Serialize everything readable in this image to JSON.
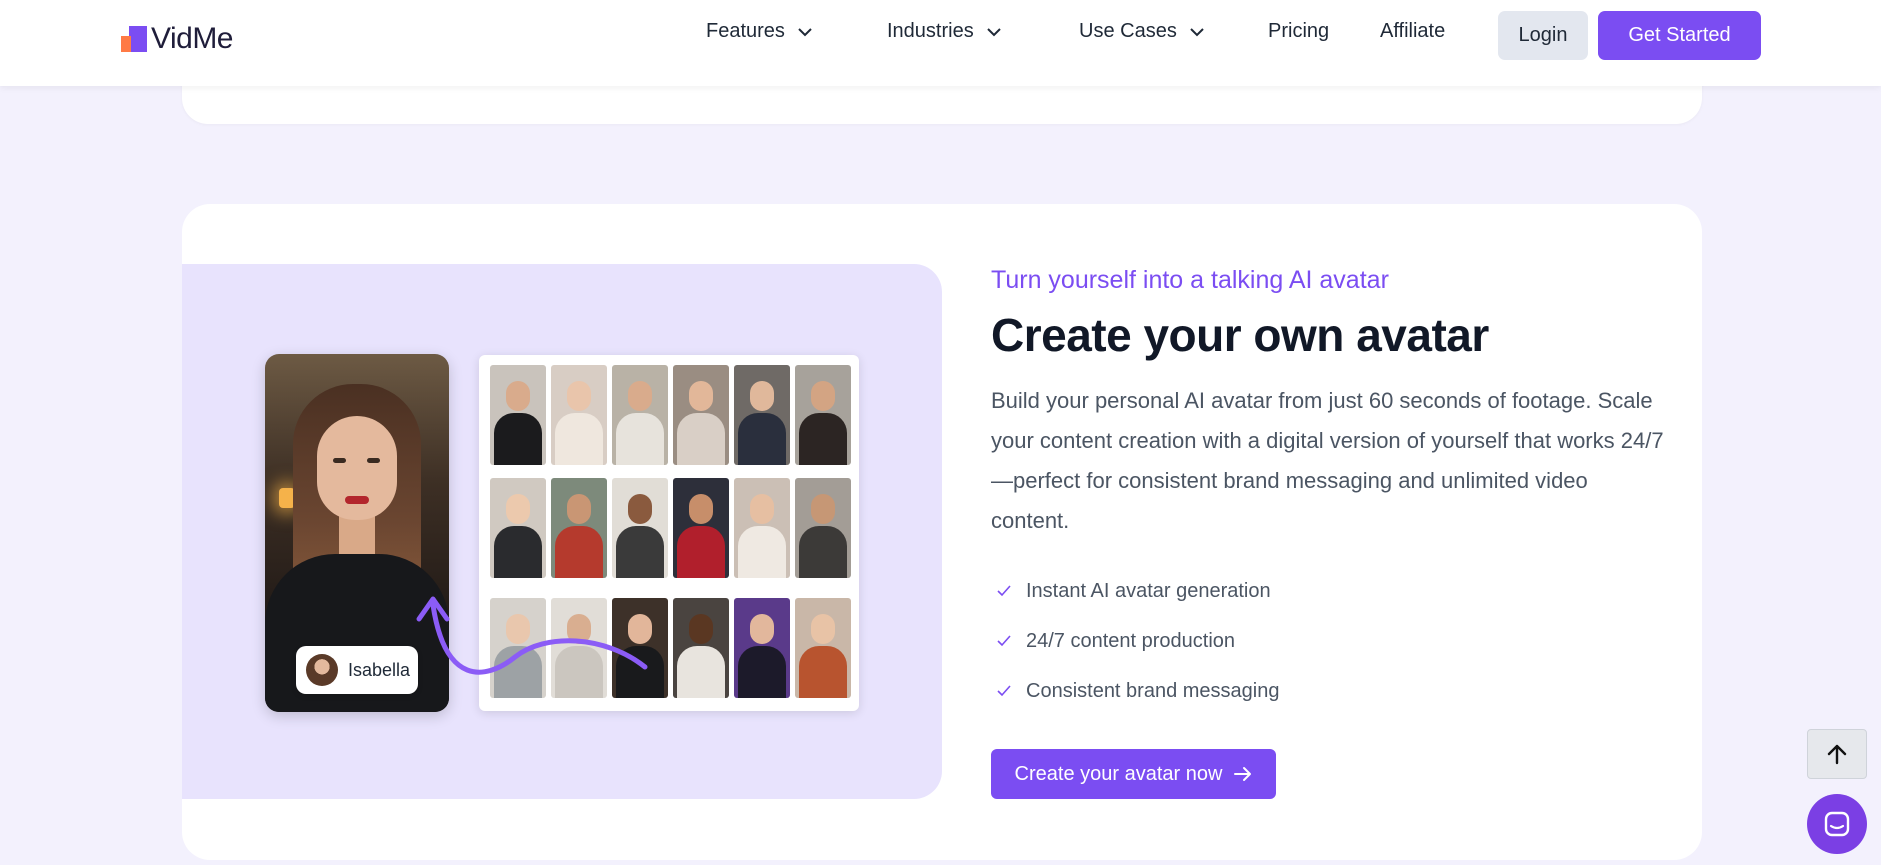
{
  "header": {
    "logo_text": "VidMe",
    "nav": {
      "features": "Features",
      "industries": "Industries",
      "use_cases": "Use Cases",
      "pricing": "Pricing",
      "affiliate": "Affiliate"
    },
    "login_label": "Login",
    "get_started_label": "Get Started"
  },
  "section": {
    "eyebrow": "Turn yourself into a talking AI avatar",
    "title": "Create your own avatar",
    "description": "Build your personal AI avatar from just 60 seconds of footage. Scale your content creation with a digital version of yourself that works 24/7—perfect for consistent brand messaging and unlimited video content.",
    "features": [
      "Instant AI avatar generation",
      "24/7 content production",
      "Consistent brand messaging"
    ],
    "cta_label": "Create your avatar now",
    "name_tag": "Isabella"
  },
  "colors": {
    "accent": "#7b4df2",
    "background": "#f3f1fd",
    "panel": "#e8e3fd"
  },
  "icons": {
    "scroll_top": "arrow-up-icon",
    "chat": "chat-icon",
    "check": "check-icon"
  }
}
